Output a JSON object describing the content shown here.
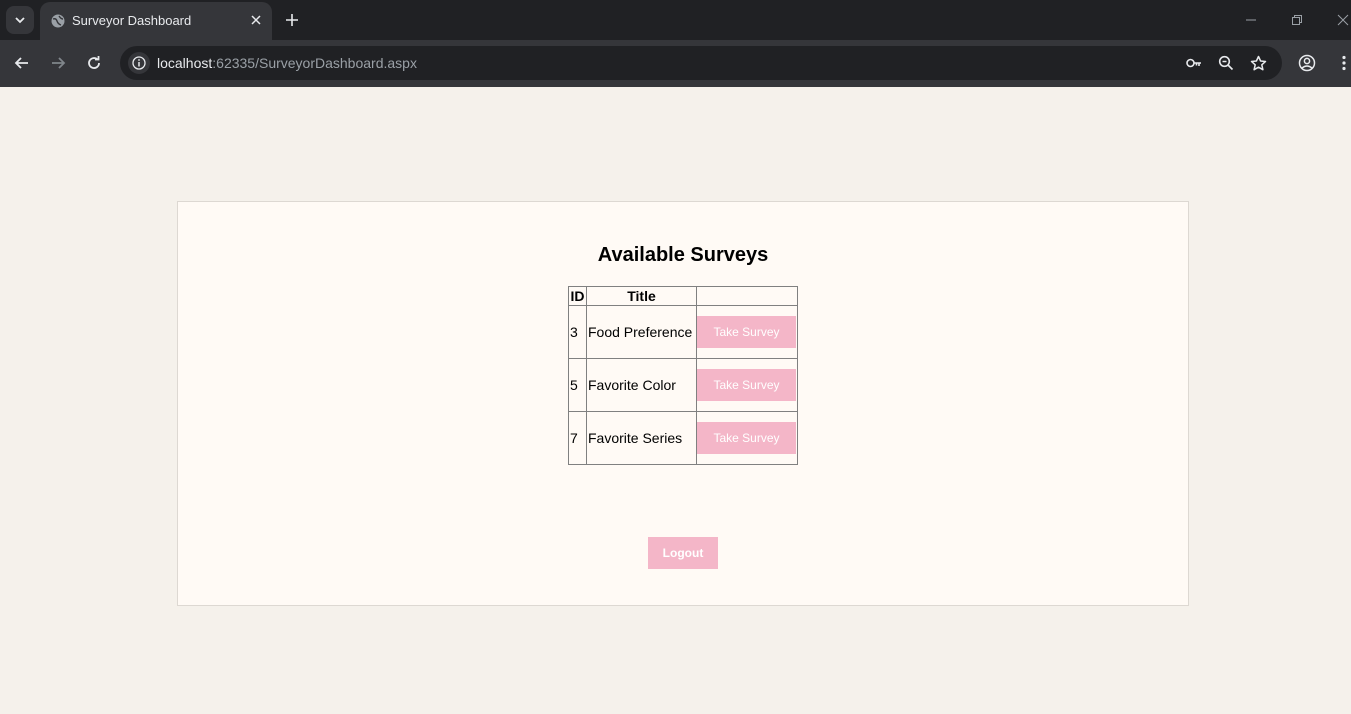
{
  "browser": {
    "tab_title": "Surveyor Dashboard",
    "url_host": "localhost",
    "url_rest": ":62335/SurveyorDashboard.aspx",
    "icons": {
      "tab_list": "chevron-down-icon",
      "favicon": "globe-icon",
      "tab_close": "close-icon",
      "new_tab": "plus-icon",
      "back": "back-arrow-icon",
      "forward": "forward-arrow-icon",
      "reload": "reload-icon",
      "site_info": "info-icon",
      "passwords": "key-icon",
      "zoom": "zoom-icon",
      "bookmark": "star-icon",
      "profile": "profile-icon",
      "menu": "kebab-menu-icon",
      "minimize": "minimize-icon",
      "restore": "restore-icon",
      "close_window": "close-icon"
    }
  },
  "page": {
    "heading": "Available Surveys",
    "table": {
      "headers": [
        "ID",
        "Title",
        ""
      ],
      "rows": [
        {
          "id": "3",
          "title": "Food Preference",
          "action": "Take Survey"
        },
        {
          "id": "5",
          "title": "Favorite Color",
          "action": "Take Survey"
        },
        {
          "id": "7",
          "title": "Favorite Series",
          "action": "Take Survey"
        }
      ]
    },
    "logout_label": "Logout"
  },
  "colors": {
    "page_background": "#f5f1eb",
    "card_background": "#fffaf5",
    "button_pink": "#f4b6c8",
    "chrome_dark": "#202124",
    "chrome_toolbar": "#35363a"
  }
}
